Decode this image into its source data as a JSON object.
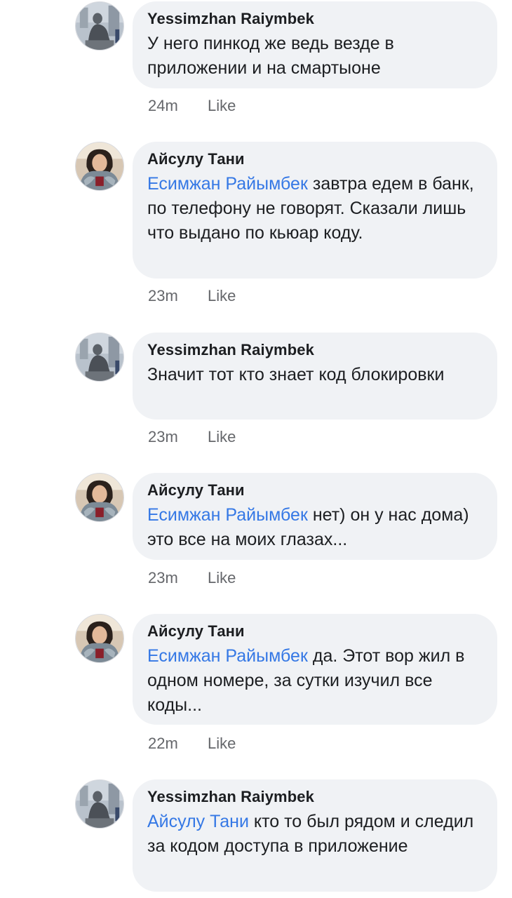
{
  "comments": [
    {
      "author": "Yessimzhan Raiymbek",
      "avatar": "statue-avatar",
      "mention": "",
      "text": "У него пинкод же ведь везде в приложении и на смартыоне",
      "time": "24m",
      "like_label": "Like"
    },
    {
      "author": "Айсулу Тани",
      "avatar": "woman-fur-avatar",
      "mention": "Есимжан Райымбек",
      "text": " завтра едем в банк, по телефону не говорят. Сказали лишь что выдано по кьюар коду.",
      "time": "23m",
      "like_label": "Like"
    },
    {
      "author": "Yessimzhan Raiymbek",
      "avatar": "statue-avatar",
      "mention": "",
      "text": "Значит тот кто знает код блокировки",
      "time": "23m",
      "like_label": "Like"
    },
    {
      "author": "Айсулу Тани",
      "avatar": "woman-fur-avatar",
      "mention": "Есимжан Райымбек",
      "text": " нет) он у нас дома) это все на моих глазах...",
      "time": "23m",
      "like_label": "Like"
    },
    {
      "author": "Айсулу Тани",
      "avatar": "woman-fur-avatar",
      "mention": "Есимжан Райымбек",
      "text": " да. Этот вор жил в одном номере, за сутки изучил все коды...",
      "time": "22m",
      "like_label": "Like"
    },
    {
      "author": "Yessimzhan Raiymbek",
      "avatar": "statue-avatar",
      "mention": "Айсулу Тани",
      "text": " кто то был рядом и следил за кодом доступа в приложение",
      "time": "",
      "like_label": ""
    }
  ],
  "colors": {
    "bubble": "#f0f2f5",
    "mention": "#3578e5",
    "meta": "#65676b"
  }
}
